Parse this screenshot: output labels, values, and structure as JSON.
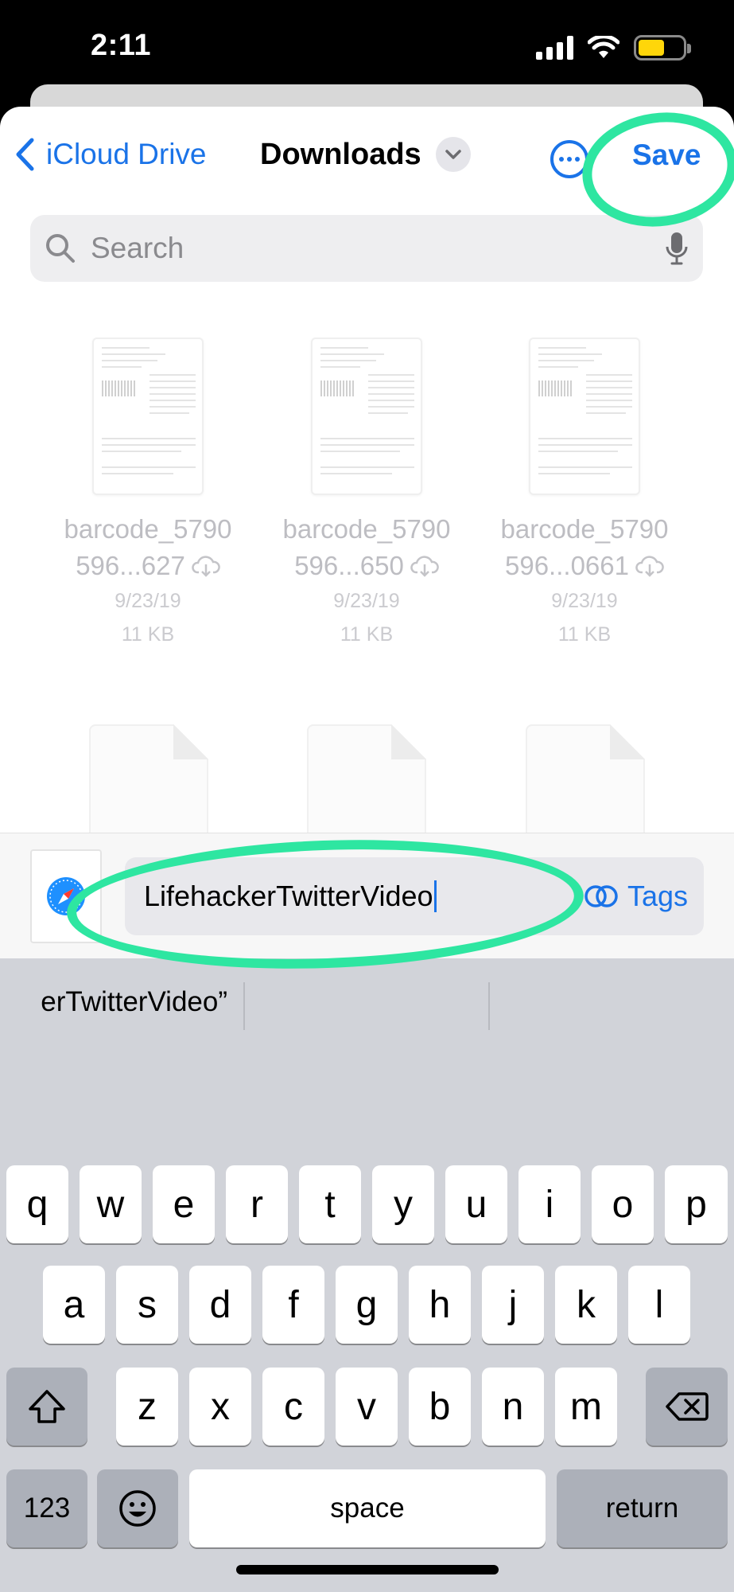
{
  "status_bar": {
    "time": "2:11",
    "battery_level": 0.6,
    "battery_color": "#ffd60a"
  },
  "nav": {
    "back_label": "iCloud Drive",
    "title": "Downloads",
    "more_icon": "ellipsis-circle-icon",
    "save_label": "Save"
  },
  "search": {
    "placeholder": "Search",
    "mic_icon": "microphone-icon"
  },
  "files": [
    {
      "name_line1": "barcode_5790",
      "name_line2": "596...627",
      "date": "9/23/19",
      "size": "11 KB"
    },
    {
      "name_line1": "barcode_5790",
      "name_line2": "596...650",
      "date": "9/23/19",
      "size": "11 KB"
    },
    {
      "name_line1": "barcode_5790",
      "name_line2": "596...0661",
      "date": "9/23/19",
      "size": "11 KB"
    }
  ],
  "save_bar": {
    "file_icon": "safari-compass-icon",
    "filename": "LifehackerTwitterVideo",
    "tags_label": "Tags"
  },
  "keyboard": {
    "suggestions": [
      "erTwitterVideo”",
      "",
      ""
    ],
    "row1": [
      "q",
      "w",
      "e",
      "r",
      "t",
      "y",
      "u",
      "i",
      "o",
      "p"
    ],
    "row2": [
      "a",
      "s",
      "d",
      "f",
      "g",
      "h",
      "j",
      "k",
      "l"
    ],
    "row3": [
      "z",
      "x",
      "c",
      "v",
      "b",
      "n",
      "m"
    ],
    "numbers_label": "123",
    "space_label": "space",
    "return_label": "return",
    "shift_icon": "shift-icon",
    "delete_icon": "delete-backspace-icon",
    "emoji_icon": "emoji-icon",
    "globe_icon": "globe-icon",
    "dictation_icon": "microphone-icon"
  },
  "colors": {
    "accent": "#1a73e8",
    "highlight_annotation": "#2ee6a1"
  }
}
